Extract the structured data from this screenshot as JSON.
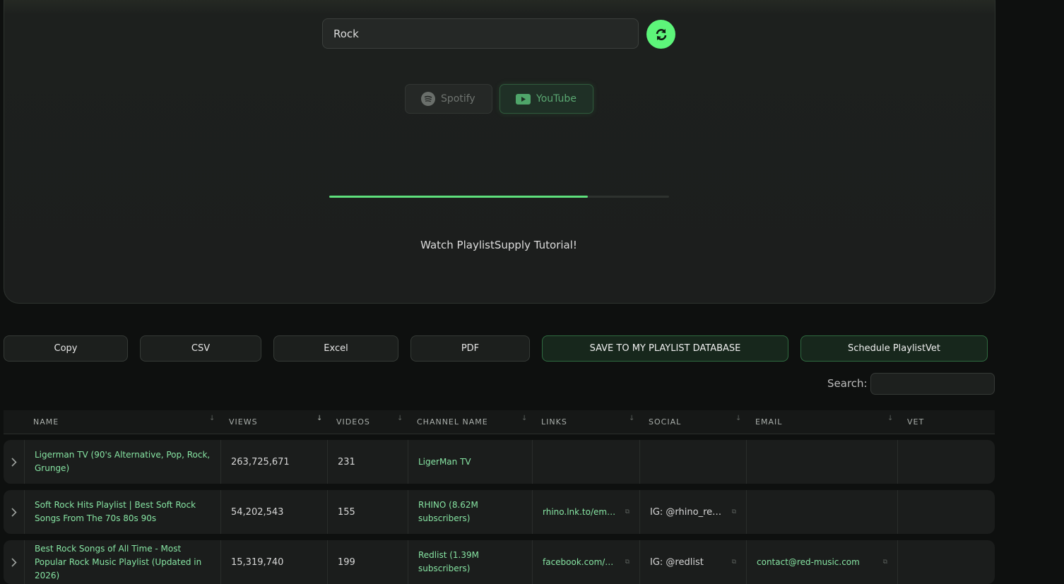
{
  "search": {
    "value": "Rock"
  },
  "platforms": {
    "spotify": "Spotify",
    "youtube": "YouTube"
  },
  "progress": {
    "fraction": 0.76
  },
  "tutorial": "Watch PlaylistSupply Tutorial!",
  "actions": {
    "copy": "Copy",
    "csv": "CSV",
    "excel": "Excel",
    "pdf": "PDF",
    "save": "SAVE TO MY PLAYLIST DATABASE",
    "schedule": "Schedule PlaylistVet"
  },
  "table_search_label": "Search:",
  "columns": [
    "NAME",
    "VIEWS",
    "VIDEOS",
    "CHANNEL NAME",
    "LINKS",
    "SOCIAL",
    "EMAIL",
    "VET"
  ],
  "rows": [
    {
      "name": "Ligerman TV (90's Alternative, Pop, Rock, Grunge)",
      "views": "263,725,671",
      "videos": "231",
      "channel": "LigerMan TV",
      "links": "",
      "social": "",
      "email": "",
      "vet": ""
    },
    {
      "name": "Soft Rock Hits Playlist | Best Soft Rock Songs From The 70s 80s 90s",
      "views": "54,202,543",
      "videos": "155",
      "channel": "RHINO (8.62M subscribers)",
      "links": "rhino.lnk.to/email...",
      "social": "IG: @rhino_recor...",
      "email": "",
      "vet": ""
    },
    {
      "name": "Best Rock Songs of All Time - Most Popular Rock Music Playlist (Updated in 2026)",
      "views": "15,319,740",
      "videos": "199",
      "channel": "Redlist (1.39M subscribers)",
      "links": "facebook.com/Re...",
      "social": "IG: @redlist",
      "email": "contact@red-music.com",
      "vet": ""
    }
  ],
  "colors": {
    "accent": "#5df57a",
    "link_green": "#86e3a2",
    "background": "#0e100f"
  },
  "icons": {
    "refresh": "refresh-icon",
    "spotify": "spotify-icon",
    "youtube": "youtube-icon",
    "expand": "chevron-right-icon",
    "external": "external-link-icon",
    "sort": "sort-arrow-icon"
  }
}
